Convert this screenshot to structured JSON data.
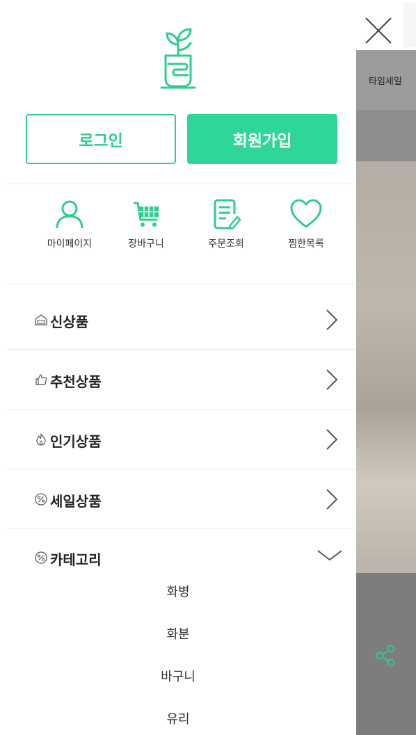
{
  "background": {
    "nav_partial": "타임세일"
  },
  "auth": {
    "login": "로그인",
    "signup": "회원가입"
  },
  "quick_links": [
    {
      "label": "마이페이지",
      "icon": "user-icon"
    },
    {
      "label": "장바구니",
      "icon": "cart-icon"
    },
    {
      "label": "주문조회",
      "icon": "order-document-icon"
    },
    {
      "label": "찜한목록",
      "icon": "heart-icon"
    }
  ],
  "menu": [
    {
      "label": "신상품",
      "icon": "new-box-icon",
      "chevron": "chevron-right-icon"
    },
    {
      "label": "추천상품",
      "icon": "thumbs-up-icon",
      "chevron": "chevron-right-icon"
    },
    {
      "label": "인기상품",
      "icon": "flame-icon",
      "chevron": "chevron-right-icon"
    },
    {
      "label": "세일상품",
      "icon": "percent-icon",
      "chevron": "chevron-right-icon"
    },
    {
      "label": "카테고리",
      "icon": "percent-icon",
      "chevron": "chevron-down-icon"
    }
  ],
  "category_items": [
    "화병",
    "화분",
    "바구니",
    "유리"
  ],
  "colors": {
    "accent": "#2ecc8d",
    "accent_fill": "#2ed697",
    "overlay": "#8e8e8e"
  }
}
